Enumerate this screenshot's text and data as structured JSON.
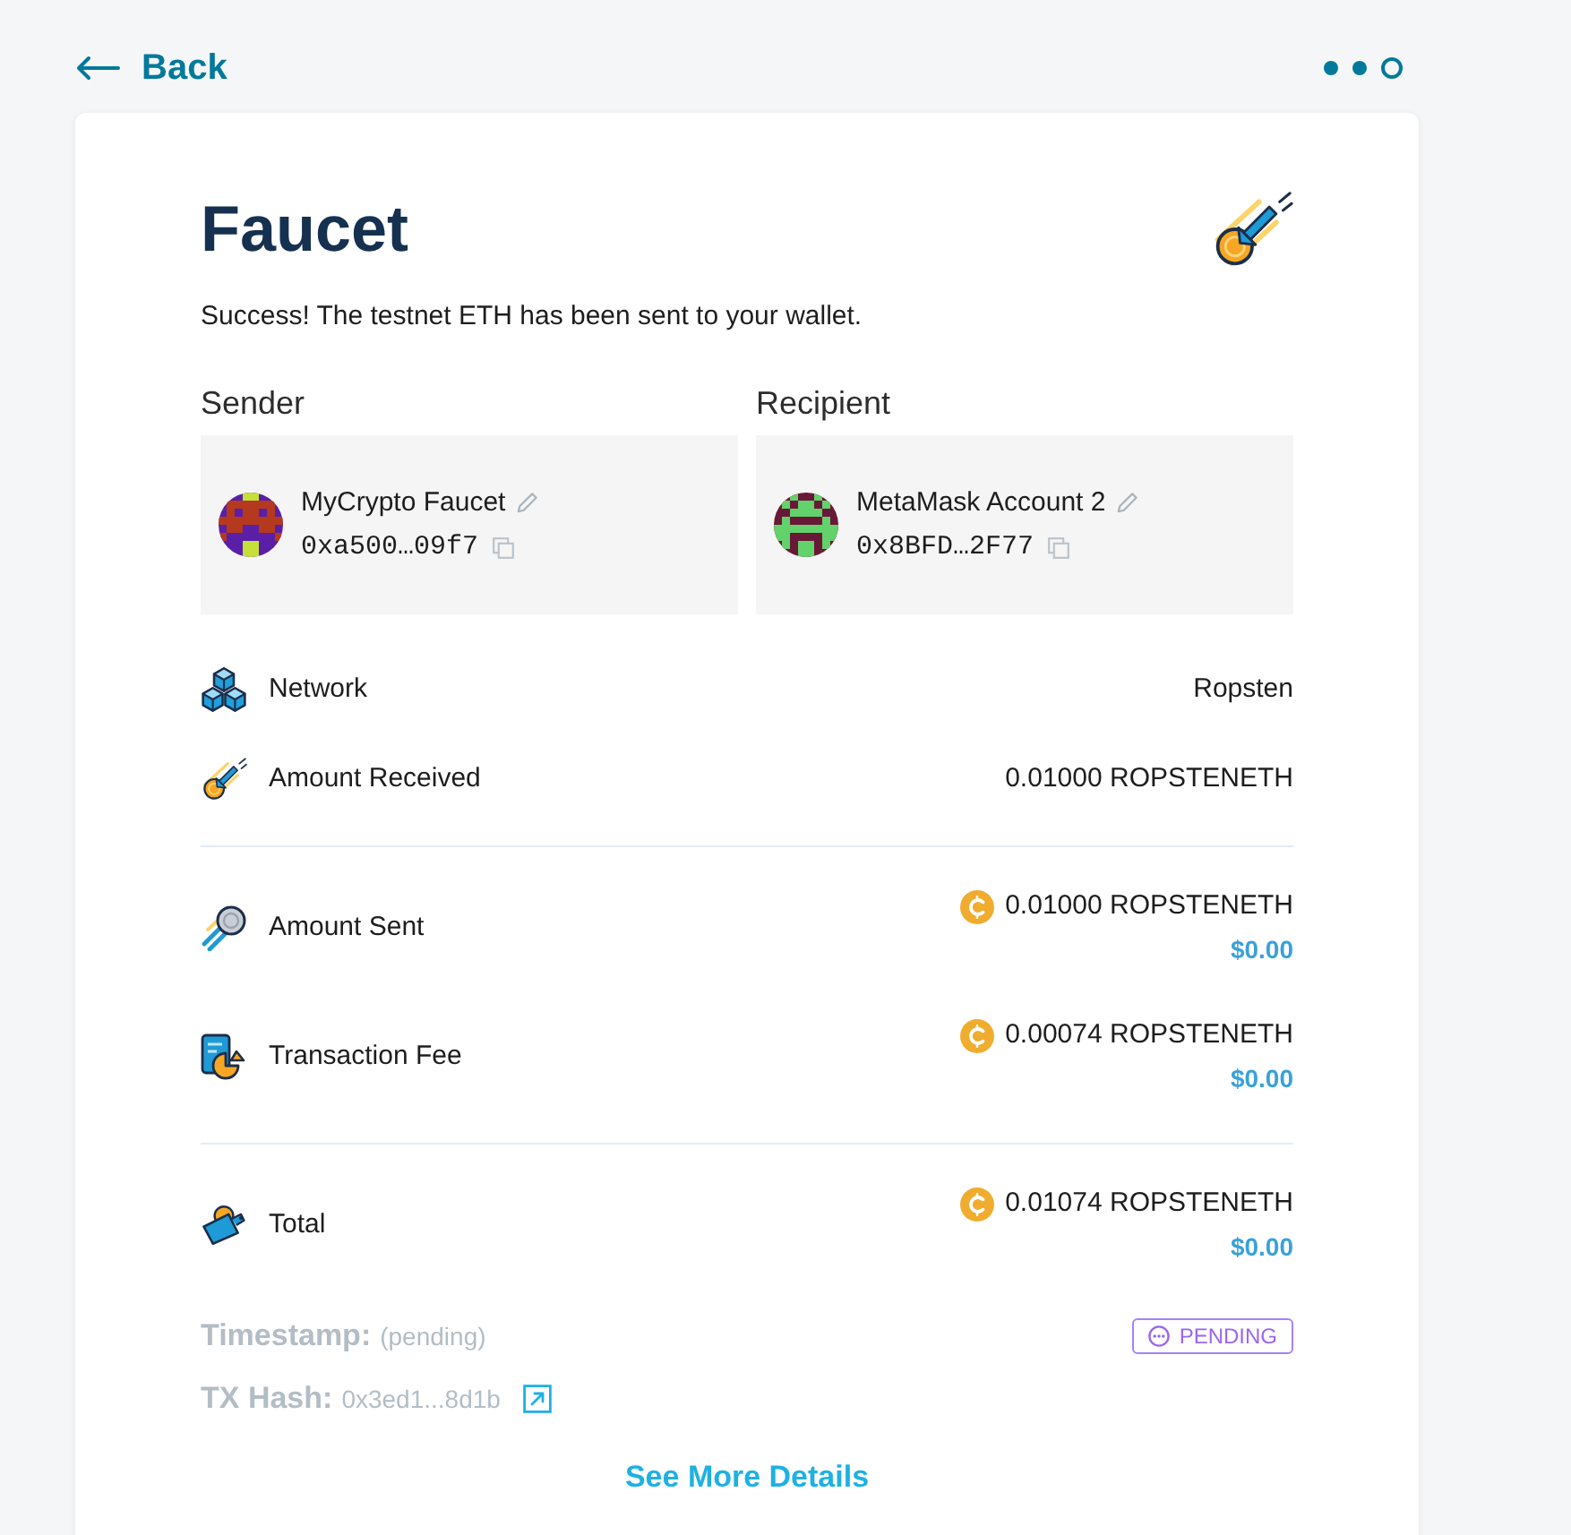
{
  "nav": {
    "back": "Back",
    "steps": [
      {
        "completed": true
      },
      {
        "completed": true
      },
      {
        "completed": false
      }
    ]
  },
  "card": {
    "title": "Faucet",
    "message": "Success! The testnet ETH has been sent to your wallet.",
    "parties": [
      {
        "role": "Sender",
        "name": "MyCrypto Faucet",
        "address": "0xa500…09f7"
      },
      {
        "role": "Recipient",
        "name": "MetaMask Account 2",
        "address": "0x8BFD…2F77"
      }
    ],
    "sections": [
      {
        "rows": [
          {
            "kind": "plain",
            "label": "Network",
            "value": "Ropsten"
          },
          {
            "kind": "plain",
            "label": "Amount Received",
            "value": "0.01000 ROPSTENETH"
          }
        ]
      },
      {
        "rows": [
          {
            "kind": "amount",
            "label": "Amount Sent",
            "value": "0.01000 ROPSTENETH",
            "fiat": "$0.00"
          },
          {
            "kind": "amount",
            "label": "Transaction Fee",
            "value": "0.00074 ROPSTENETH",
            "fiat": "$0.00"
          }
        ]
      },
      {
        "rows": [
          {
            "kind": "amount",
            "label": "Total",
            "value": "0.01074 ROPSTENETH",
            "fiat": "$0.00"
          }
        ]
      }
    ],
    "timestamp": {
      "label": "Timestamp:",
      "value": "(pending)",
      "status": "PENDING"
    },
    "tx_hash": {
      "label": "TX Hash:",
      "value": "0x3ed1...8d1b"
    },
    "details_link": "See More Details"
  }
}
